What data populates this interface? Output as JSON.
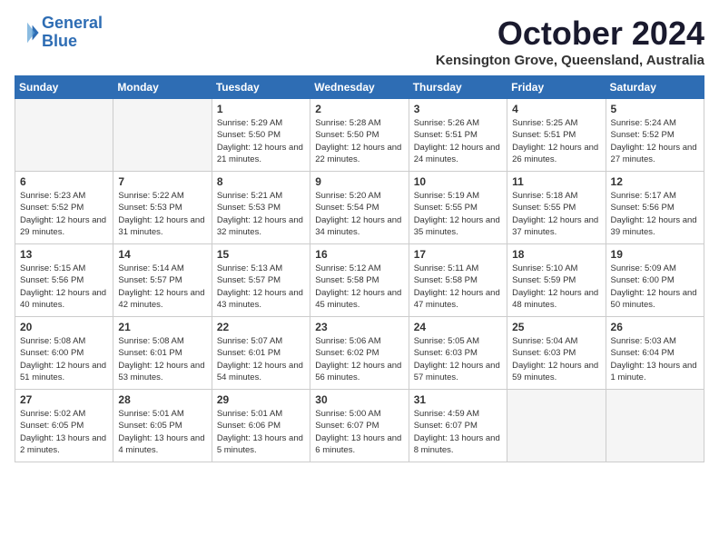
{
  "header": {
    "logo_line1": "General",
    "logo_line2": "Blue",
    "month": "October 2024",
    "location": "Kensington Grove, Queensland, Australia"
  },
  "weekdays": [
    "Sunday",
    "Monday",
    "Tuesday",
    "Wednesday",
    "Thursday",
    "Friday",
    "Saturday"
  ],
  "weeks": [
    [
      {
        "day": "",
        "info": ""
      },
      {
        "day": "",
        "info": ""
      },
      {
        "day": "1",
        "info": "Sunrise: 5:29 AM\nSunset: 5:50 PM\nDaylight: 12 hours and 21 minutes."
      },
      {
        "day": "2",
        "info": "Sunrise: 5:28 AM\nSunset: 5:50 PM\nDaylight: 12 hours and 22 minutes."
      },
      {
        "day": "3",
        "info": "Sunrise: 5:26 AM\nSunset: 5:51 PM\nDaylight: 12 hours and 24 minutes."
      },
      {
        "day": "4",
        "info": "Sunrise: 5:25 AM\nSunset: 5:51 PM\nDaylight: 12 hours and 26 minutes."
      },
      {
        "day": "5",
        "info": "Sunrise: 5:24 AM\nSunset: 5:52 PM\nDaylight: 12 hours and 27 minutes."
      }
    ],
    [
      {
        "day": "6",
        "info": "Sunrise: 5:23 AM\nSunset: 5:52 PM\nDaylight: 12 hours and 29 minutes."
      },
      {
        "day": "7",
        "info": "Sunrise: 5:22 AM\nSunset: 5:53 PM\nDaylight: 12 hours and 31 minutes."
      },
      {
        "day": "8",
        "info": "Sunrise: 5:21 AM\nSunset: 5:53 PM\nDaylight: 12 hours and 32 minutes."
      },
      {
        "day": "9",
        "info": "Sunrise: 5:20 AM\nSunset: 5:54 PM\nDaylight: 12 hours and 34 minutes."
      },
      {
        "day": "10",
        "info": "Sunrise: 5:19 AM\nSunset: 5:55 PM\nDaylight: 12 hours and 35 minutes."
      },
      {
        "day": "11",
        "info": "Sunrise: 5:18 AM\nSunset: 5:55 PM\nDaylight: 12 hours and 37 minutes."
      },
      {
        "day": "12",
        "info": "Sunrise: 5:17 AM\nSunset: 5:56 PM\nDaylight: 12 hours and 39 minutes."
      }
    ],
    [
      {
        "day": "13",
        "info": "Sunrise: 5:15 AM\nSunset: 5:56 PM\nDaylight: 12 hours and 40 minutes."
      },
      {
        "day": "14",
        "info": "Sunrise: 5:14 AM\nSunset: 5:57 PM\nDaylight: 12 hours and 42 minutes."
      },
      {
        "day": "15",
        "info": "Sunrise: 5:13 AM\nSunset: 5:57 PM\nDaylight: 12 hours and 43 minutes."
      },
      {
        "day": "16",
        "info": "Sunrise: 5:12 AM\nSunset: 5:58 PM\nDaylight: 12 hours and 45 minutes."
      },
      {
        "day": "17",
        "info": "Sunrise: 5:11 AM\nSunset: 5:58 PM\nDaylight: 12 hours and 47 minutes."
      },
      {
        "day": "18",
        "info": "Sunrise: 5:10 AM\nSunset: 5:59 PM\nDaylight: 12 hours and 48 minutes."
      },
      {
        "day": "19",
        "info": "Sunrise: 5:09 AM\nSunset: 6:00 PM\nDaylight: 12 hours and 50 minutes."
      }
    ],
    [
      {
        "day": "20",
        "info": "Sunrise: 5:08 AM\nSunset: 6:00 PM\nDaylight: 12 hours and 51 minutes."
      },
      {
        "day": "21",
        "info": "Sunrise: 5:08 AM\nSunset: 6:01 PM\nDaylight: 12 hours and 53 minutes."
      },
      {
        "day": "22",
        "info": "Sunrise: 5:07 AM\nSunset: 6:01 PM\nDaylight: 12 hours and 54 minutes."
      },
      {
        "day": "23",
        "info": "Sunrise: 5:06 AM\nSunset: 6:02 PM\nDaylight: 12 hours and 56 minutes."
      },
      {
        "day": "24",
        "info": "Sunrise: 5:05 AM\nSunset: 6:03 PM\nDaylight: 12 hours and 57 minutes."
      },
      {
        "day": "25",
        "info": "Sunrise: 5:04 AM\nSunset: 6:03 PM\nDaylight: 12 hours and 59 minutes."
      },
      {
        "day": "26",
        "info": "Sunrise: 5:03 AM\nSunset: 6:04 PM\nDaylight: 13 hours and 1 minute."
      }
    ],
    [
      {
        "day": "27",
        "info": "Sunrise: 5:02 AM\nSunset: 6:05 PM\nDaylight: 13 hours and 2 minutes."
      },
      {
        "day": "28",
        "info": "Sunrise: 5:01 AM\nSunset: 6:05 PM\nDaylight: 13 hours and 4 minutes."
      },
      {
        "day": "29",
        "info": "Sunrise: 5:01 AM\nSunset: 6:06 PM\nDaylight: 13 hours and 5 minutes."
      },
      {
        "day": "30",
        "info": "Sunrise: 5:00 AM\nSunset: 6:07 PM\nDaylight: 13 hours and 6 minutes."
      },
      {
        "day": "31",
        "info": "Sunrise: 4:59 AM\nSunset: 6:07 PM\nDaylight: 13 hours and 8 minutes."
      },
      {
        "day": "",
        "info": ""
      },
      {
        "day": "",
        "info": ""
      }
    ]
  ]
}
